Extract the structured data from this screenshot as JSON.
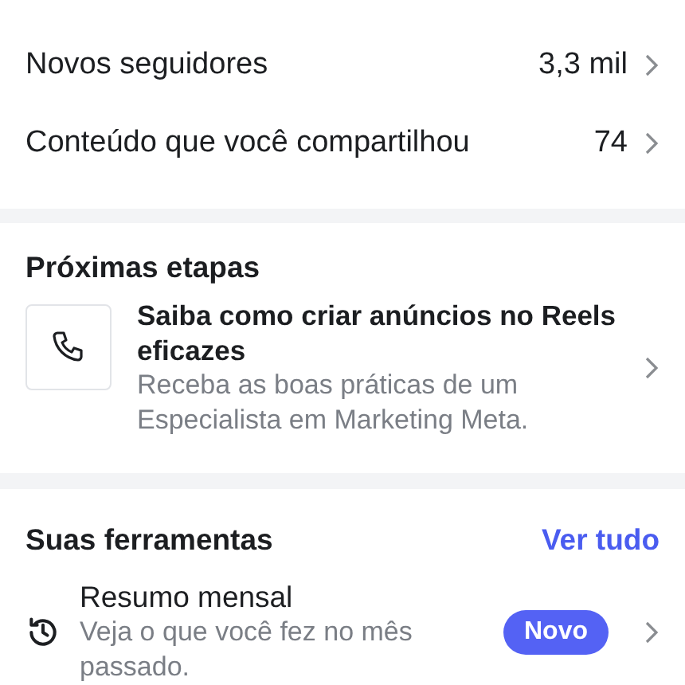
{
  "stats": [
    {
      "label": "Novos seguidores",
      "value": "3,3 mil"
    },
    {
      "label": "Conteúdo que você compartilhou",
      "value": "74"
    }
  ],
  "next_steps": {
    "title": "Próximas etapas",
    "items": [
      {
        "title": "Saiba como criar anúncios no Reels eficazes",
        "description": "Receba as boas práticas de um Especialista em Marketing Meta."
      }
    ]
  },
  "tools": {
    "title": "Suas ferramentas",
    "see_all": "Ver tudo",
    "items": [
      {
        "title": "Resumo mensal",
        "description": "Veja o que você fez no mês passado.",
        "badge": "Novo"
      }
    ]
  }
}
